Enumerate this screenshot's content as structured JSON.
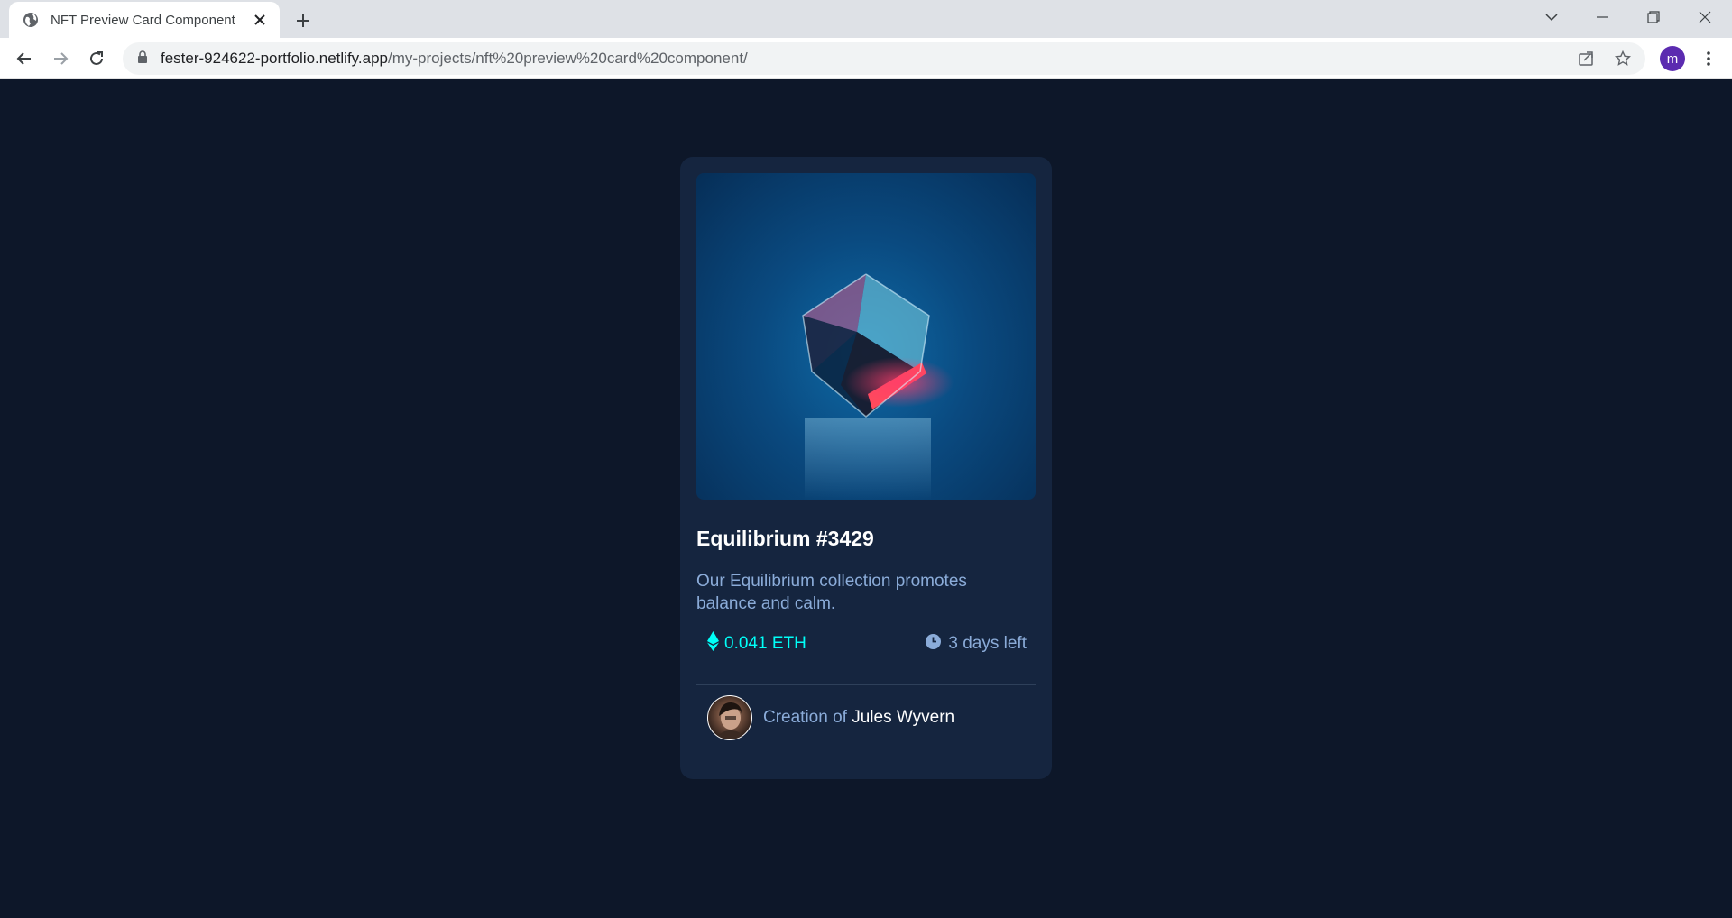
{
  "browser": {
    "tab_title": "NFT Preview Card Component",
    "url_host": "fester-924622-portfolio.netlify.app",
    "url_path": "/my-projects/nft%20preview%20card%20component/",
    "profile_initial": "m"
  },
  "card": {
    "title": "Equilibrium #3429",
    "description": "Our Equilibrium collection promotes balance and calm.",
    "price": "0.041 ETH",
    "time_left": "3 days left",
    "creator_prefix": "Creation of",
    "creator_name": "Jules Wyvern"
  },
  "colors": {
    "page_bg": "#0d1729",
    "card_bg": "#15253f",
    "accent_cyan": "#00fff8",
    "soft_blue": "#8bacd9",
    "white": "#ffffff"
  },
  "icons": {
    "price": "ethereum-icon",
    "time": "clock-icon"
  }
}
